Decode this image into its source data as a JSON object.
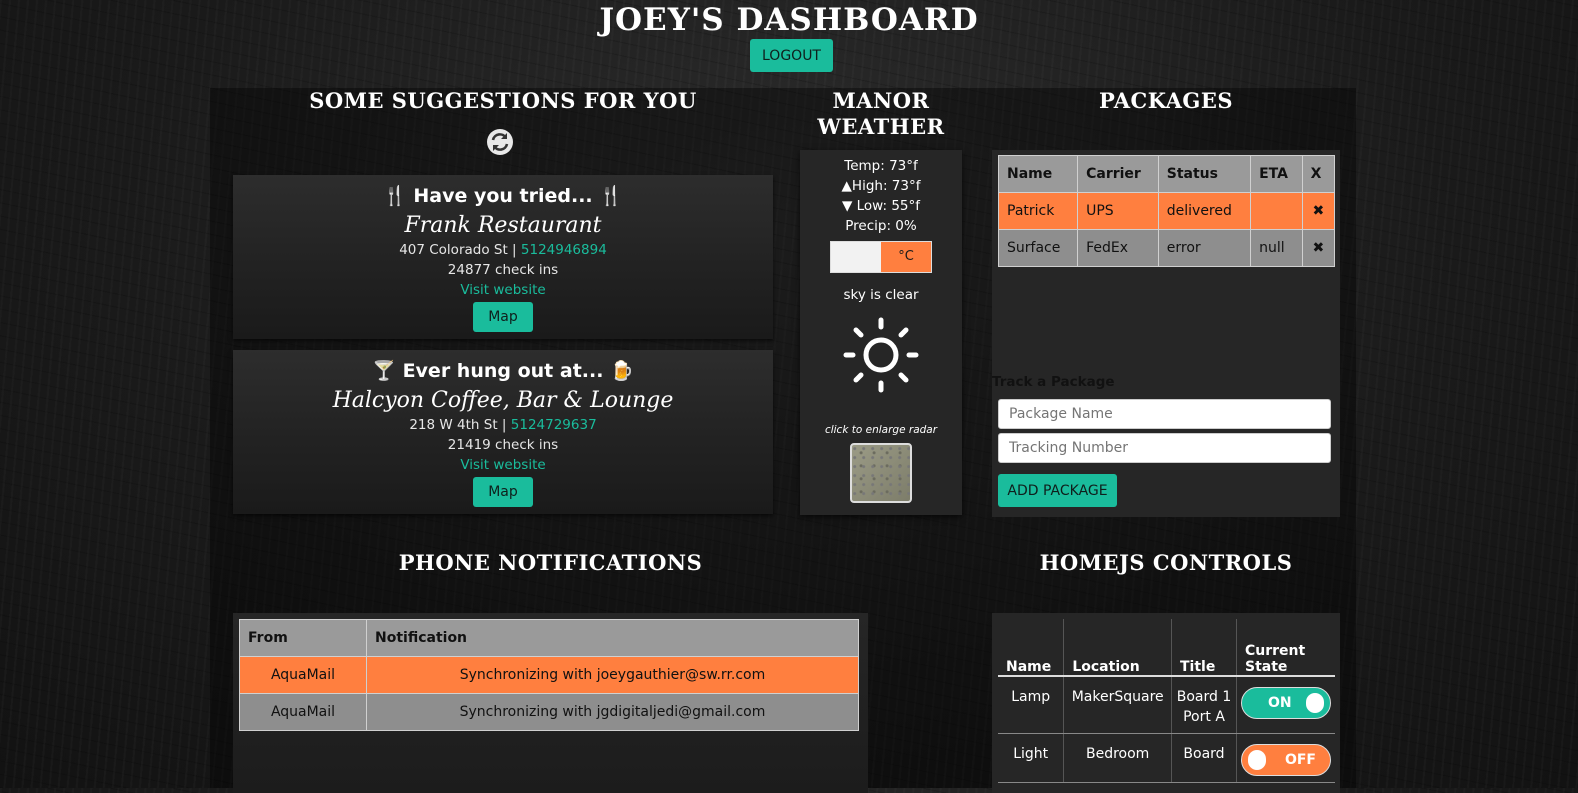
{
  "header": {
    "title": "JOEY'S DASHBOARD",
    "logout_label": "LOGOUT"
  },
  "suggestions": {
    "heading": "SOME SUGGESTIONS FOR YOU",
    "items": [
      {
        "prompt": "Have you tried...",
        "icon": "fork-knife-icon",
        "name": "Frank Restaurant",
        "address": "407 Colorado St",
        "separator": " | ",
        "phone": "5124946894",
        "checkins": "24877 check ins",
        "website_label": "Visit website",
        "map_label": "Map"
      },
      {
        "prompt": "Ever hung out at...",
        "icon": "cocktail-icon",
        "name": "Halcyon Coffee, Bar & Lounge",
        "address": "218 W 4th St",
        "separator": " | ",
        "phone": "5124729637",
        "checkins": "21419 check ins",
        "website_label": "Visit website",
        "map_label": "Map"
      }
    ]
  },
  "weather": {
    "heading_line1": "MANOR",
    "heading_line2": "WEATHER",
    "temp": "Temp: 73°f",
    "high": "▲High: 73°f",
    "low": "▼ Low: 55°f",
    "precip": "Precip: 0%",
    "unit_label": "°C",
    "condition": "sky is clear",
    "radar_caption": "click to enlarge radar",
    "icon": "sun-icon"
  },
  "packages": {
    "heading": "PACKAGES",
    "columns": [
      "Name",
      "Carrier",
      "Status",
      "ETA",
      "X"
    ],
    "rows": [
      {
        "name": "Patrick",
        "carrier": "UPS",
        "status": "delivered",
        "eta": "",
        "delete": "✖"
      },
      {
        "name": "Surface",
        "carrier": "FedEx",
        "status": "error",
        "eta": "null",
        "delete": "✖"
      }
    ],
    "track_label": "Track a Package",
    "name_placeholder": "Package Name",
    "tracking_placeholder": "Tracking Number",
    "add_label": "ADD PACKAGE"
  },
  "notifications": {
    "heading": "PHONE NOTIFICATIONS",
    "columns": [
      "From",
      "Notification"
    ],
    "rows": [
      {
        "from": "AquaMail",
        "text": "Synchronizing with joeygauthier@sw.rr.com"
      },
      {
        "from": "AquaMail",
        "text": "Synchronizing with jgdigitaljedi@gmail.com"
      }
    ]
  },
  "homejs": {
    "heading": "HOMEJS CONTROLS",
    "columns": [
      "Name",
      "Location",
      "Title",
      "Current State"
    ],
    "rows": [
      {
        "name": "Lamp",
        "location": "MakerSquare",
        "title": "Board 1 Port A",
        "state": "ON"
      },
      {
        "name": "Light",
        "location": "Bedroom",
        "title": "Board",
        "state": "OFF"
      }
    ]
  },
  "colors": {
    "accent": "#1abc9c",
    "highlight": "#ff7f3f",
    "panel": "#262626"
  }
}
